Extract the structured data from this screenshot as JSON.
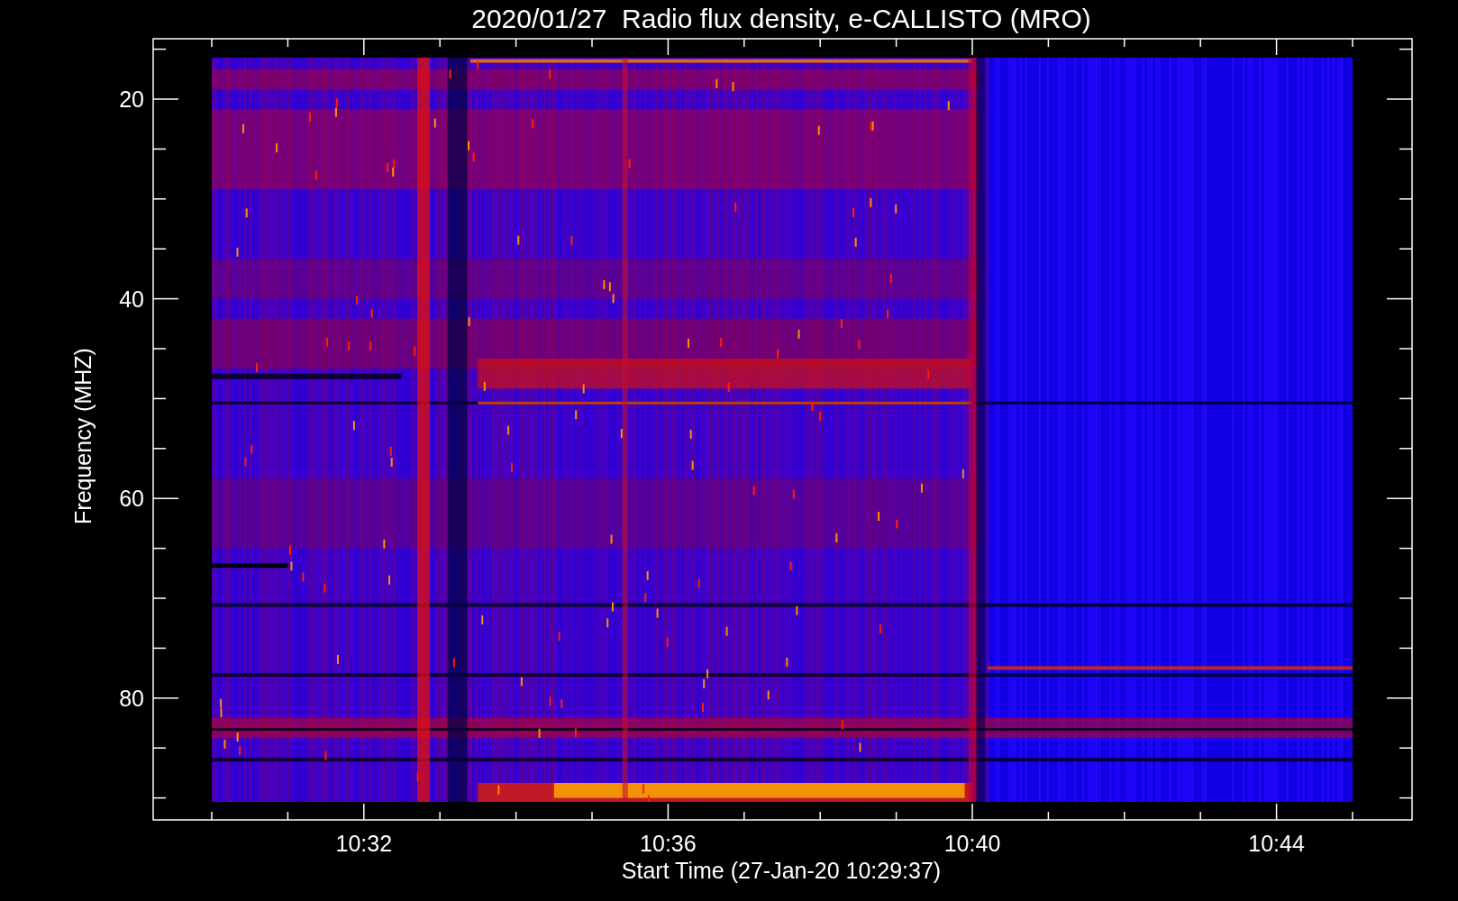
{
  "title": "2020/01/27  Radio flux density, e-CALLISTO (MRO)",
  "y_axis": {
    "label": "Frequency (MHZ)",
    "ticks": [
      "20",
      "40",
      "60",
      "80"
    ]
  },
  "x_axis": {
    "label": "Start Time (27-Jan-20 10:29:37)",
    "ticks": [
      "10:32",
      "10:36",
      "10:40",
      "10:44"
    ]
  }
}
